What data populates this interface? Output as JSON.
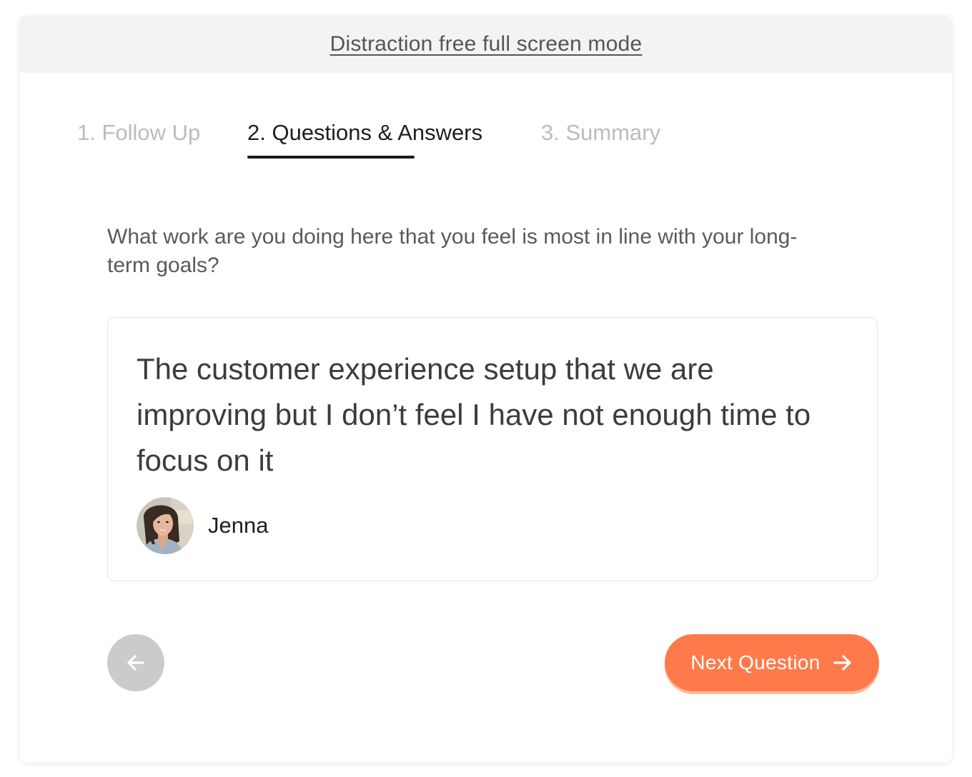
{
  "topbar": {
    "link_label": "Distraction free full screen mode"
  },
  "tabs": [
    {
      "label": "1. Follow Up",
      "active": false
    },
    {
      "label": "2. Questions & Answers",
      "active": true
    },
    {
      "label": "3. Summary",
      "active": false
    }
  ],
  "question": {
    "text": "What work are you doing here that you feel is most in line with your long-term goals?"
  },
  "answer": {
    "text": "The customer experience setup that we are improving but I don’t feel I have not enough time to focus on it",
    "author_name": "Jenna"
  },
  "navigation": {
    "back_icon": "arrow-left-icon",
    "next_label": "Next Question",
    "next_icon": "arrow-right-icon"
  },
  "colors": {
    "accent": "#ff7a4a",
    "back_button": "#cbcbcb",
    "topbar_bg": "#f4f3f1"
  }
}
